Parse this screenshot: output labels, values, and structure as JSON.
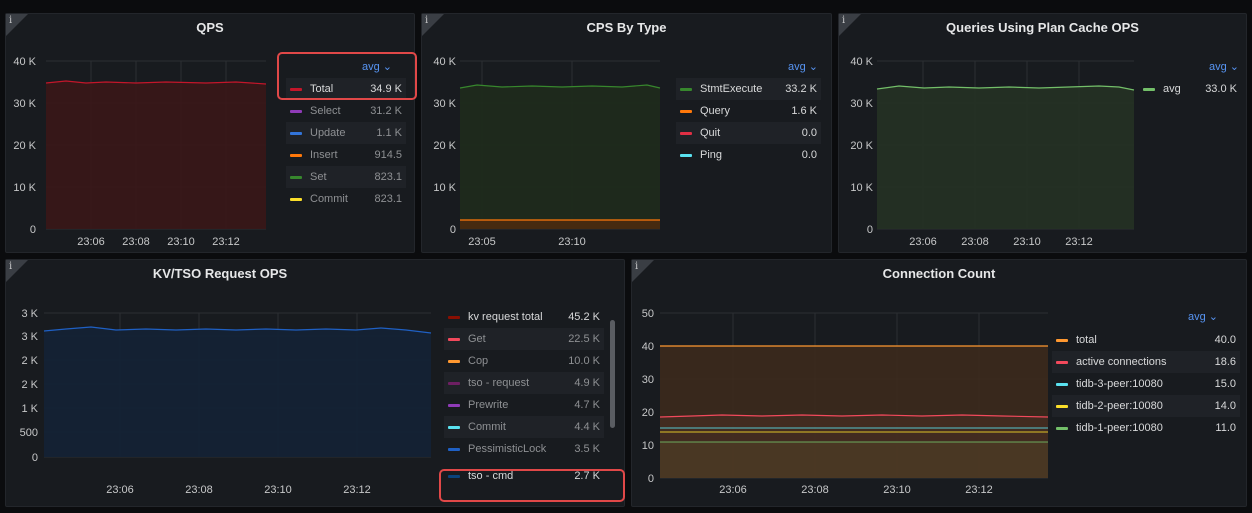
{
  "panels": {
    "qps": {
      "title": "QPS",
      "y_ticks": [
        "40 K",
        "30 K",
        "20 K",
        "10 K",
        "0"
      ],
      "x_ticks": [
        "23:06",
        "23:08",
        "23:10",
        "23:12"
      ],
      "legend_header": "avg ⌄",
      "legend": [
        {
          "name": "Total",
          "value": "34.9 K",
          "color": "#c4162a",
          "highlighted": true,
          "dimmed": false
        },
        {
          "name": "Select",
          "value": "31.2 K",
          "color": "#8f3bb8",
          "highlighted": false,
          "dimmed": true
        },
        {
          "name": "Update",
          "value": "1.1 K",
          "color": "#3274d9",
          "highlighted": false,
          "dimmed": true
        },
        {
          "name": "Insert",
          "value": "914.5",
          "color": "#ff780a",
          "highlighted": false,
          "dimmed": true
        },
        {
          "name": "Set",
          "value": "823.1",
          "color": "#37872d",
          "highlighted": false,
          "dimmed": true
        },
        {
          "name": "Commit",
          "value": "823.1",
          "color": "#fade2a",
          "highlighted": false,
          "dimmed": true
        }
      ]
    },
    "cps": {
      "title": "CPS By Type",
      "y_ticks": [
        "40 K",
        "30 K",
        "20 K",
        "10 K",
        "0"
      ],
      "x_ticks": [
        "23:05",
        "23:10"
      ],
      "legend_header": "avg ⌄",
      "legend": [
        {
          "name": "StmtExecute",
          "value": "33.2 K",
          "color": "#37872d"
        },
        {
          "name": "Query",
          "value": "1.6 K",
          "color": "#ff780a"
        },
        {
          "name": "Quit",
          "value": "0.0",
          "color": "#e02f44"
        },
        {
          "name": "Ping",
          "value": "0.0",
          "color": "#5ae2f0"
        }
      ]
    },
    "plancache": {
      "title": "Queries Using Plan Cache OPS",
      "y_ticks": [
        "40 K",
        "30 K",
        "20 K",
        "10 K",
        "0"
      ],
      "x_ticks": [
        "23:06",
        "23:08",
        "23:10",
        "23:12"
      ],
      "legend_header": "avg ⌄",
      "legend": [
        {
          "name": "avg",
          "value": "33.0 K",
          "color": "#73bf69"
        }
      ]
    },
    "kvtso": {
      "title": "KV/TSO Request OPS",
      "y_ticks": [
        "3 K",
        "3 K",
        "2 K",
        "2 K",
        "1 K",
        "500",
        "0"
      ],
      "x_ticks": [
        "23:06",
        "23:08",
        "23:10",
        "23:12"
      ],
      "legend": [
        {
          "name": "kv request total",
          "value": "45.2 K",
          "color": "#890f02",
          "highlighted": false,
          "dimmed": false
        },
        {
          "name": "Get",
          "value": "22.5 K",
          "color": "#f2495c",
          "highlighted": false,
          "dimmed": true
        },
        {
          "name": "Cop",
          "value": "10.0 K",
          "color": "#ff9830",
          "highlighted": false,
          "dimmed": true
        },
        {
          "name": "tso - request",
          "value": "4.9 K",
          "color": "#6d1f62",
          "highlighted": false,
          "dimmed": true
        },
        {
          "name": "Prewrite",
          "value": "4.7 K",
          "color": "#8f3bb8",
          "highlighted": false,
          "dimmed": true
        },
        {
          "name": "Commit",
          "value": "4.4 K",
          "color": "#5ae2f0",
          "highlighted": false,
          "dimmed": true
        },
        {
          "name": "PessimisticLock",
          "value": "3.5 K",
          "color": "#1f60c4",
          "highlighted": false,
          "dimmed": true
        },
        {
          "name": "tso - cmd",
          "value": "2.7 K",
          "color": "#0a437c",
          "highlighted": true,
          "dimmed": false
        }
      ]
    },
    "conn": {
      "title": "Connection Count",
      "y_ticks": [
        "50",
        "40",
        "30",
        "20",
        "10",
        "0"
      ],
      "x_ticks": [
        "23:06",
        "23:08",
        "23:10",
        "23:12"
      ],
      "legend_header": "avg ⌄",
      "legend": [
        {
          "name": "total",
          "value": "40.0",
          "color": "#ff9830"
        },
        {
          "name": "active connections",
          "value": "18.6",
          "color": "#f2495c"
        },
        {
          "name": "tidb-3-peer:10080",
          "value": "15.0",
          "color": "#5ae2f0"
        },
        {
          "name": "tidb-2-peer:10080",
          "value": "14.0",
          "color": "#fade2a"
        },
        {
          "name": "tidb-1-peer:10080",
          "value": "11.0",
          "color": "#73bf69"
        }
      ]
    }
  },
  "info_icon_glyph": "i"
}
